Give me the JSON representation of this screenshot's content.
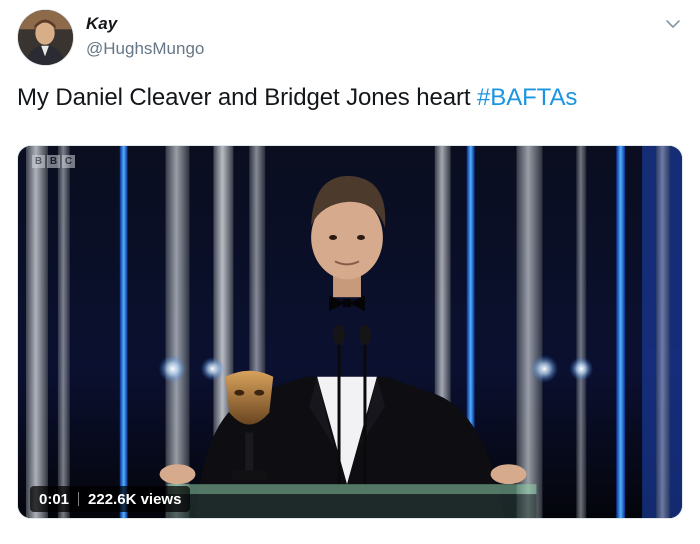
{
  "author": {
    "display_name": "Kay",
    "handle": "@HughsMungo",
    "avatar_icon": "profile-photo-icon"
  },
  "menu": {
    "icon": "chevron-down-icon"
  },
  "tweet": {
    "text_prefix": "My Daniel Cleaver and Bridget Jones heart ",
    "hashtag": "#BAFTAs",
    "hashtag_color": "#1b95e0"
  },
  "media": {
    "watermark_letters": [
      "B",
      "B",
      "C"
    ],
    "timestamp": "0:01",
    "views": "222.6K views"
  },
  "colors": {
    "text": "#14171a",
    "secondary_text": "#657786",
    "stage_blue": "#1d6fd8"
  }
}
